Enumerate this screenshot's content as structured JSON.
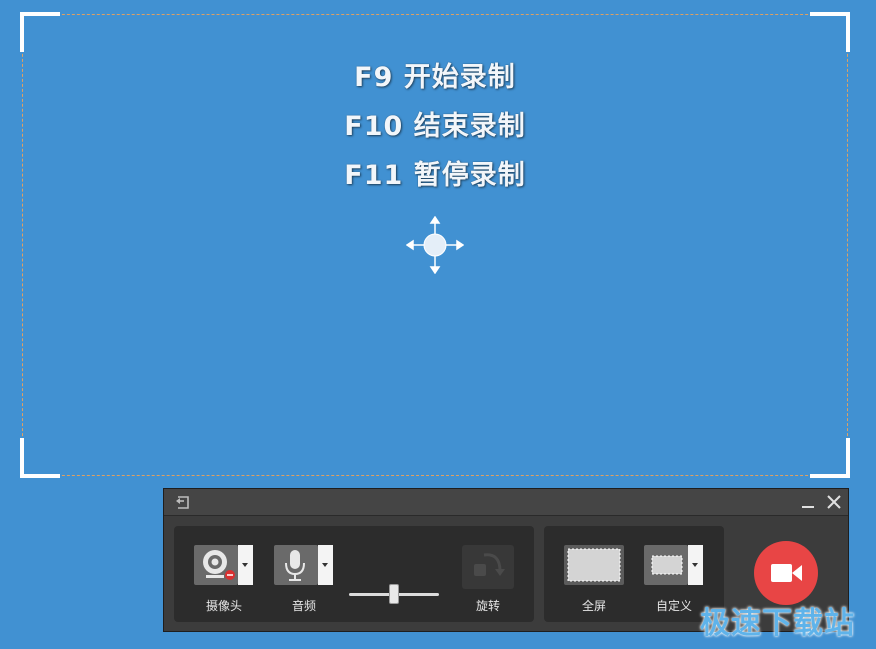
{
  "colors": {
    "background": "#4191d2",
    "region_border": "#e0a060",
    "toolbar_bg": "#3c3c3c",
    "panel_bg": "#2c2c2c",
    "record_red": "#e84545",
    "watermark": "#5fb3ea"
  },
  "capture_region": {
    "hotkeys": [
      "F9 开始录制",
      "F10 结束录制",
      "F11 暂停录制"
    ],
    "move_icon": "move-arrows-icon"
  },
  "toolbar": {
    "back_icon": "back-icon",
    "minimize_icon": "minimize-icon",
    "close_icon": "close-icon",
    "camera": {
      "label": "摄像头",
      "icon": "webcam-icon"
    },
    "audio": {
      "label": "音频",
      "icon": "microphone-icon",
      "volume_level": 0.5
    },
    "rotate": {
      "label": "旋转",
      "icon": "rotate-icon"
    },
    "fullscreen": {
      "label": "全屏",
      "icon": "fullscreen-icon"
    },
    "custom": {
      "label": "自定义",
      "icon": "custom-area-icon"
    },
    "record_icon": "video-camera-icon"
  },
  "watermark": "极速下载站"
}
